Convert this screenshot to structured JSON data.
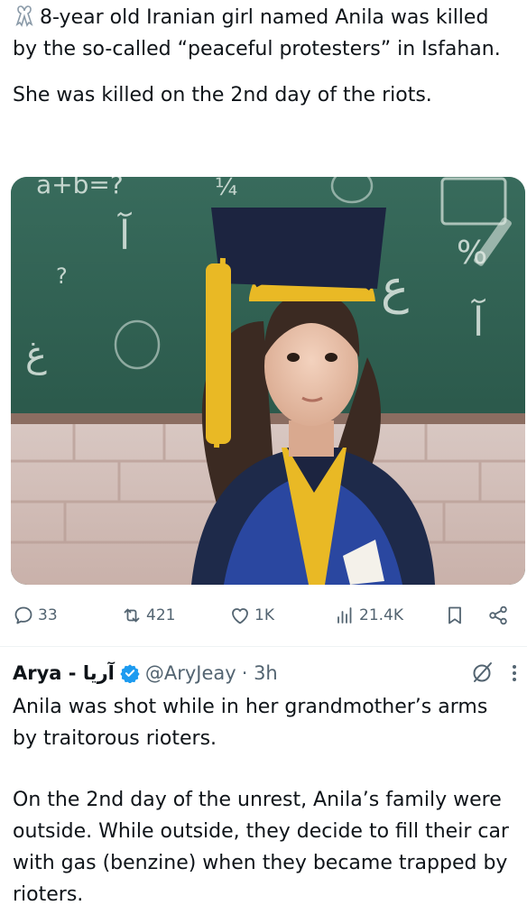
{
  "tweet1": {
    "line1": "8-year old Iranian girl named Anila was killed by the so-called “peaceful protesters” in Isfahan.",
    "line2": "She was killed on the 2nd day of the riots.",
    "emoji_icon": "ribbon-icon"
  },
  "media": {
    "chalk": {
      "eq": "a+b=?",
      "alef1": "آ",
      "q": "?",
      "ghayn": "غ",
      "ayn": "ع",
      "pct": "%",
      "alef2": "آ",
      "frac": "¼"
    }
  },
  "actions": {
    "replies": "33",
    "reposts": "421",
    "likes": "1K",
    "views": "21.4K"
  },
  "tweet2": {
    "display_name": "Arya - آریا",
    "handle": "@AryJeay",
    "time": "· 3h",
    "para1": "Anila was shot while in her grandmother’s arms by traitorous rioters.",
    "para2": "On the 2nd day of the unrest, Anila’s family were outside. While outside, they decide to fill their car with gas (benzine) when they became trapped by rioters."
  },
  "colors": {
    "text": "#0f1419",
    "muted": "#536471",
    "verified": "#1d9bf0",
    "chalkboard": "#2f5d4f"
  }
}
